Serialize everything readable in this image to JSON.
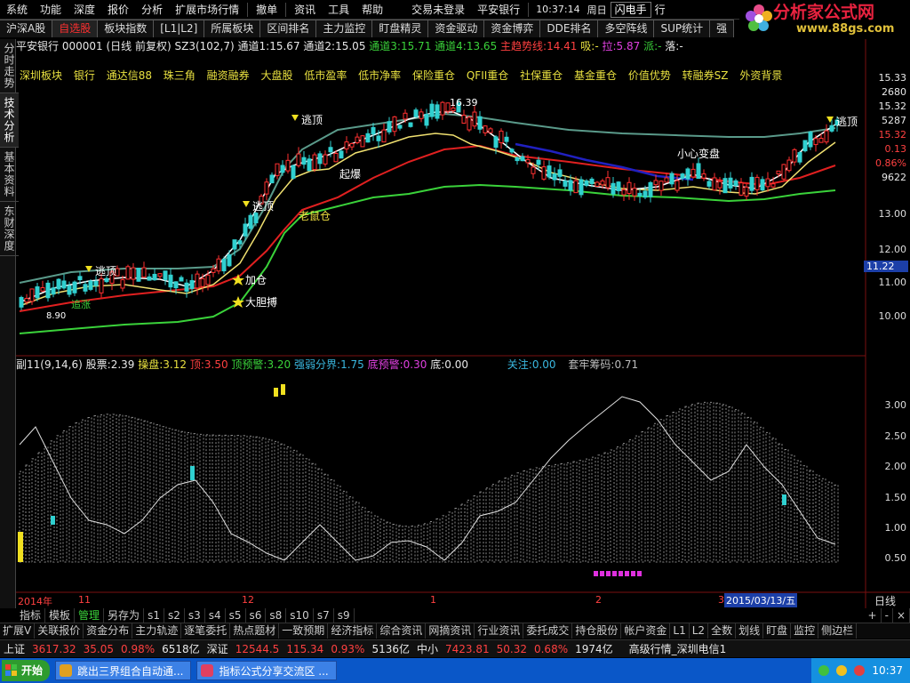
{
  "menu": {
    "items": [
      "系统",
      "功能",
      "深度",
      "报价",
      "分析",
      "扩展市场行情",
      "撤单",
      "资讯",
      "工具",
      "帮助"
    ],
    "login_status": "交易未登录",
    "broker": "平安银行",
    "time": "10:37:14",
    "weekday": "周日",
    "flash_button": "闪电手",
    "extra": "行"
  },
  "logo": {
    "brand": "分析家公式网",
    "url": "www.88gs.com"
  },
  "tabs": [
    "沪深A股",
    "自选股",
    "板块指数",
    "[L1|L2]",
    "所属板块",
    "区间排名",
    "主力监控",
    "盯盘精灵",
    "资金驱动",
    "资金博弈",
    "DDE排名",
    "多空阵线",
    "SUP统计",
    "强"
  ],
  "active_tab": 1,
  "vtabs": [
    "分时走势",
    "技术分析",
    "基本资料",
    "东财深度"
  ],
  "info": {
    "stock": "平安银行",
    "code": "000001",
    "period": "(日线 前复权)",
    "indicator": "SZ3(102,7)",
    "ch1_label": "通道1:",
    "ch1": "15.67",
    "ch2_label": "通道2:",
    "ch2": "15.05",
    "ch3_label": "通道3:",
    "ch3": "15.71",
    "ch4_label": "通道4:",
    "ch4": "13.65",
    "trend_label": "主趋势线:",
    "trend": "14.41",
    "suck_label": "吸:",
    "suck": "-",
    "pull_label": "拉:",
    "pull": "5.87",
    "send_label": "派:",
    "send": "-",
    "fall_label": "落:",
    "fall": "-"
  },
  "concepts": [
    "深圳板块",
    "银行",
    "通达信88",
    "珠三角",
    "融资融券",
    "大盘股",
    "低市盈率",
    "低市净率",
    "保险重仓",
    "QFII重仓",
    "社保重仓",
    "基金重仓",
    "价值优势",
    "转融券SZ",
    "外资背景"
  ],
  "annotations": {
    "escape": "逃顶",
    "add": "加仓",
    "bold": "大胆搏",
    "rat": "老鼠仓",
    "rise": "起爆",
    "careful": "小心变盘",
    "high_price": "16.39",
    "low_price": "8.90",
    "chase": "追涨"
  },
  "right_axis": {
    "top": [
      "15.33",
      "2680",
      "15.32",
      "5287",
      "15.32",
      "0.13",
      "0.86%",
      "9622"
    ],
    "ticks": [
      "13.00",
      "12.00",
      "11.00",
      "10.00"
    ],
    "current_price": "11.22",
    "sub_ticks": [
      "3.00",
      "2.50",
      "2.00",
      "1.50",
      "1.00",
      "0.50"
    ]
  },
  "sub": {
    "name": "副11(9,14,6)",
    "stock_label": "股票:",
    "stock": "2.39",
    "op_label": "操盘:",
    "op": "3.12",
    "top_label": "顶:",
    "top": "3.50",
    "topwarn_label": "顶预警:",
    "topwarn": "3.20",
    "div_label": "强弱分界:",
    "div": "1.75",
    "bottomwarn_label": "底预警:",
    "bottomwarn": "0.30",
    "bottom_label": "底:",
    "bottom": "0.00",
    "focus_label": "关注:",
    "focus": "0.00",
    "trap_label": "套牢筹码:",
    "trap": "0.71"
  },
  "time_axis": {
    "year": "2014年",
    "labels": [
      "11",
      "12",
      "1",
      "2",
      "3"
    ],
    "cursor": "2015/03/13/五",
    "mode": "日线"
  },
  "toolbar1": [
    "指标",
    "模板",
    "管理",
    "另存为",
    "s1",
    "s2",
    "s3",
    "s4",
    "s5",
    "s6",
    "s8",
    "s10",
    "s7",
    "s9"
  ],
  "toolbar1_right": [
    "+",
    "-",
    "×"
  ],
  "toolbar2": [
    "扩展V",
    "关联报价",
    "资金分布",
    "主力轨迹",
    "逐笔委托",
    "热点题材",
    "一致预期",
    "经济指标",
    "综合资讯",
    "网摘资讯",
    "行业资讯",
    "委托成交",
    "持仓股份",
    "帐户资金",
    "L1",
    "L2",
    "全数",
    "划线",
    "盯盘",
    "监控",
    "侧边栏"
  ],
  "status": {
    "sh_label": "上证",
    "sh": "3617.32",
    "sh_chg": "35.05",
    "sh_pct": "0.98%",
    "sh_amt": "6518亿",
    "sz_label": "深证",
    "sz": "12544.5",
    "sz_chg": "115.34",
    "sz_pct": "0.93%",
    "sz_amt": "5136亿",
    "mid_label": "中小",
    "mid": "7423.81",
    "mid_chg": "50.32",
    "mid_pct": "0.68%",
    "mid_amt": "1974亿",
    "feed": "高级行情_深圳电信1"
  },
  "taskbar": {
    "start": "开始",
    "tasks": [
      "跳出三界组合自动通...",
      "指标公式分享交流区 ..."
    ],
    "clock": "10:37"
  },
  "chart_data": {
    "type": "candlestick",
    "x": [
      "2014-10",
      "2014-11",
      "2014-12",
      "2015-01",
      "2015-02",
      "2015-03"
    ],
    "ylim": [
      9.5,
      16.8
    ],
    "sub_ylim": [
      0,
      3.5
    ],
    "grid": false
  }
}
